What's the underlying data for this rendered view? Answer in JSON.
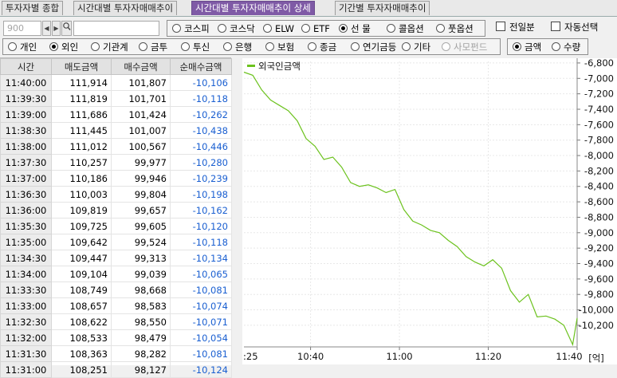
{
  "tabs": [
    {
      "label": "투자자별 종합",
      "active": false
    },
    {
      "label": "시간대별 투자자매매추이",
      "active": false
    },
    {
      "label": "시간대별 투자자매매추이 상세",
      "active": true
    },
    {
      "label": "기간별 투자자매매추이",
      "active": false
    }
  ],
  "code_field": {
    "value": "900"
  },
  "market_options": [
    {
      "label": "코스피",
      "selected": false
    },
    {
      "label": "코스닥",
      "selected": false
    },
    {
      "label": "ELW",
      "selected": false
    },
    {
      "label": "ETF",
      "selected": false
    },
    {
      "label": "선 물",
      "selected": true
    },
    {
      "label": "콜옵션",
      "selected": false
    },
    {
      "label": "풋옵션",
      "selected": false
    }
  ],
  "checkboxes": [
    {
      "label": "전일분",
      "checked": false
    },
    {
      "label": "자동선택",
      "checked": false
    }
  ],
  "investor_options": [
    {
      "label": "개인",
      "selected": false,
      "disabled": false
    },
    {
      "label": "외인",
      "selected": true,
      "disabled": false
    },
    {
      "label": "기관계",
      "selected": false,
      "disabled": false
    },
    {
      "label": "금투",
      "selected": false,
      "disabled": false
    },
    {
      "label": "투신",
      "selected": false,
      "disabled": false
    },
    {
      "label": "은행",
      "selected": false,
      "disabled": false
    },
    {
      "label": "보험",
      "selected": false,
      "disabled": false
    },
    {
      "label": "종금",
      "selected": false,
      "disabled": false
    },
    {
      "label": "연기금등",
      "selected": false,
      "disabled": false
    },
    {
      "label": "기타",
      "selected": false,
      "disabled": false
    },
    {
      "label": "사모펀드",
      "selected": false,
      "disabled": true
    }
  ],
  "unit_options": [
    {
      "label": "금액",
      "selected": true
    },
    {
      "label": "수량",
      "selected": false
    }
  ],
  "table": {
    "headers": [
      "시간",
      "매도금액",
      "매수금액",
      "순매수금액"
    ],
    "rows": [
      [
        "11:40:00",
        "111,914",
        "101,807",
        "-10,106"
      ],
      [
        "11:39:30",
        "111,819",
        "101,701",
        "-10,118"
      ],
      [
        "11:39:00",
        "111,686",
        "101,424",
        "-10,262"
      ],
      [
        "11:38:30",
        "111,445",
        "101,007",
        "-10,438"
      ],
      [
        "11:38:00",
        "111,012",
        "100,567",
        "-10,446"
      ],
      [
        "11:37:30",
        "110,257",
        "99,977",
        "-10,280"
      ],
      [
        "11:37:00",
        "110,186",
        "99,946",
        "-10,239"
      ],
      [
        "11:36:30",
        "110,003",
        "99,804",
        "-10,198"
      ],
      [
        "11:36:00",
        "109,819",
        "99,657",
        "-10,162"
      ],
      [
        "11:35:30",
        "109,725",
        "99,605",
        "-10,120"
      ],
      [
        "11:35:00",
        "109,642",
        "99,524",
        "-10,118"
      ],
      [
        "11:34:30",
        "109,447",
        "99,313",
        "-10,134"
      ],
      [
        "11:34:00",
        "109,104",
        "99,039",
        "-10,065"
      ],
      [
        "11:33:30",
        "108,749",
        "98,668",
        "-10,081"
      ],
      [
        "11:33:00",
        "108,657",
        "98,583",
        "-10,074"
      ],
      [
        "11:32:30",
        "108,622",
        "98,550",
        "-10,071"
      ],
      [
        "11:32:00",
        "108,533",
        "98,479",
        "-10,054"
      ],
      [
        "11:31:30",
        "108,363",
        "98,282",
        "-10,081"
      ],
      [
        "11:31:00",
        "108,251",
        "98,127",
        "-10,124"
      ]
    ]
  },
  "chart_data": {
    "type": "line",
    "series": [
      {
        "name": "외국인금액",
        "color": "#6cc21e",
        "x": [
          "10:25",
          "10:27",
          "10:29",
          "10:31",
          "10:33",
          "10:35",
          "10:37",
          "10:39",
          "10:41",
          "10:43",
          "10:45",
          "10:47",
          "10:49",
          "10:51",
          "10:53",
          "10:55",
          "10:57",
          "10:59",
          "11:01",
          "11:03",
          "11:05",
          "11:07",
          "11:09",
          "11:11",
          "11:13",
          "11:15",
          "11:17",
          "11:19",
          "11:21",
          "11:23",
          "11:25",
          "11:27",
          "11:29",
          "11:31",
          "11:33",
          "11:35",
          "11:37",
          "11:39",
          "11:40"
        ],
        "y": [
          -6920,
          -6960,
          -7150,
          -7280,
          -7350,
          -7420,
          -7550,
          -7780,
          -7880,
          -8050,
          -8020,
          -8150,
          -8350,
          -8400,
          -8380,
          -8420,
          -8480,
          -8440,
          -8700,
          -8850,
          -8900,
          -8970,
          -9000,
          -9100,
          -9180,
          -9310,
          -9380,
          -9430,
          -9350,
          -9460,
          -9750,
          -9900,
          -9800,
          -10090,
          -10080,
          -10120,
          -10200,
          -10450,
          -10106
        ]
      }
    ],
    "x_ticks": [
      "10:40",
      "11:00",
      "11:20",
      "11:40"
    ],
    "x_edge_label": ":25",
    "y_ticks": [
      -6800,
      -7000,
      -7200,
      -7400,
      -7600,
      -7800,
      -8000,
      -8200,
      -8400,
      -8600,
      -8800,
      -9000,
      -9200,
      -9400,
      -9600,
      -9800,
      -10000,
      -10200
    ],
    "ylim": [
      -10480,
      -6780
    ],
    "y_unit": "[억]",
    "grid": true
  }
}
